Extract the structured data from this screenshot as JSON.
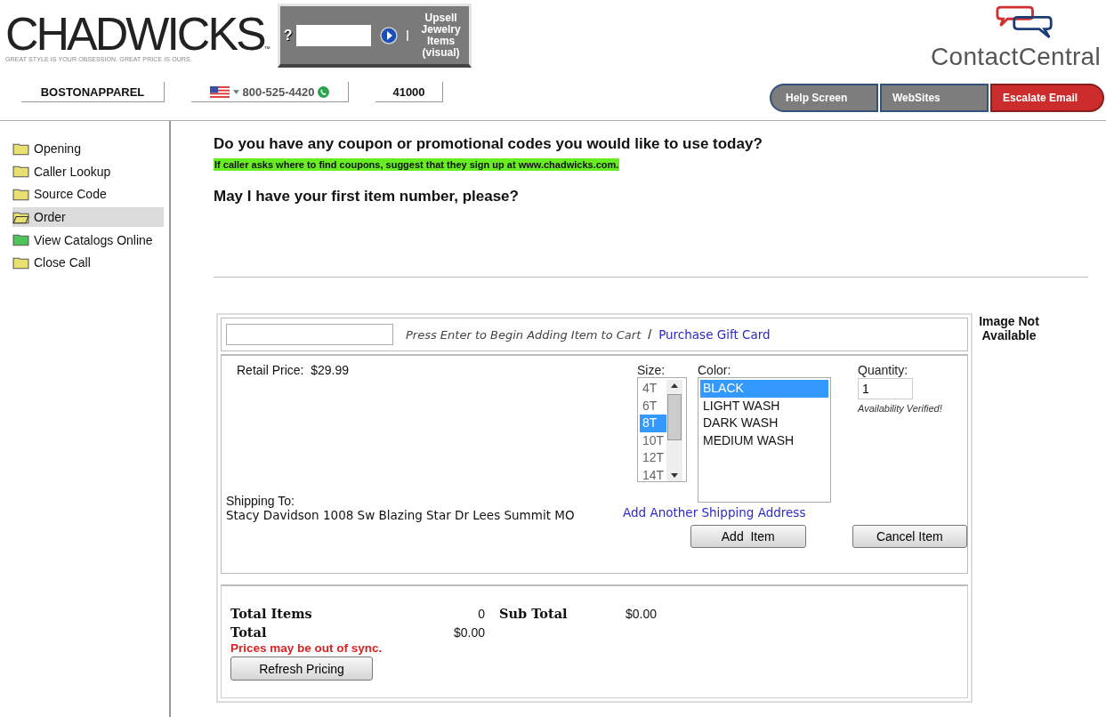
{
  "header": {
    "logo": {
      "name": "CHADWICKS",
      "trademark": "™",
      "tagline": "GREAT STYLE IS YOUR OBSESSION. GREAT PRICE IS OURS."
    },
    "search_box": {
      "help": "?",
      "link": "Upsell Jewelry Items (visual)"
    },
    "brand": "ContactCentral",
    "account": "BOSTONAPPAREL",
    "phone": "800-525-4420",
    "code": "41000",
    "buttons": [
      {
        "label": "Help Screen",
        "kind": "grey"
      },
      {
        "label": "WebSites",
        "kind": "grey"
      },
      {
        "label": "Escalate Email",
        "kind": "red"
      }
    ]
  },
  "sidebar": {
    "items": [
      {
        "label": "Opening",
        "selected": false,
        "color": "#e8e070"
      },
      {
        "label": "Caller Lookup",
        "selected": false,
        "color": "#e8e070"
      },
      {
        "label": "Source Code",
        "selected": false,
        "color": "#e8e070"
      },
      {
        "label": "Order",
        "selected": true,
        "color": "#e8e070"
      },
      {
        "label": "View Catalogs Online",
        "selected": false,
        "color": "#4cc45a"
      },
      {
        "label": "Close Call",
        "selected": false,
        "color": "#e8e070"
      }
    ]
  },
  "script": {
    "question": "Do you have any coupon or promotional codes you would like to use today?",
    "hint": "If caller asks where to find coupons, suggest that they sign up at www.chadwicks.com.",
    "question_2": "May I have your first item number, please?"
  },
  "order": {
    "entry_hint": "Press Enter to Begin Adding Item to Cart",
    "separator": "/",
    "gift_link": "Purchase Gift Card",
    "retail_label": "Retail Price:",
    "retail_price": "$29.99",
    "size_label": "Size:",
    "sizes": [
      {
        "label": "4T",
        "selected": false
      },
      {
        "label": "6T",
        "selected": false
      },
      {
        "label": "8T",
        "selected": true
      },
      {
        "label": "10T",
        "selected": false
      },
      {
        "label": "12T",
        "selected": false
      },
      {
        "label": "14T",
        "selected": false
      }
    ],
    "color_label": "Color:",
    "colors": [
      {
        "label": "BLACK",
        "selected": true
      },
      {
        "label": "LIGHT WASH",
        "selected": false
      },
      {
        "label": "DARK WASH",
        "selected": false
      },
      {
        "label": "MEDIUM WASH",
        "selected": false
      }
    ],
    "quantity_label": "Quantity:",
    "quantity": "1",
    "availability": "Availability Verified!",
    "shipping_label": "Shipping To:",
    "shipping_address": "Stacy Davidson 1008 Sw Blazing Star Dr Lees Summit MO",
    "shipping_link": "Add Another Shipping Address",
    "add_button": "Add  Item",
    "cancel_button": "Cancel Item",
    "image_note": "Image Not Available"
  },
  "totals": {
    "items_label": "Total Items",
    "items": "0",
    "subtotal_label": "Sub Total",
    "subtotal": "$0.00",
    "total_label": "Total",
    "total": "$0.00",
    "warning": "Prices may be out of sync.",
    "refresh_button": "Refresh Pricing"
  }
}
